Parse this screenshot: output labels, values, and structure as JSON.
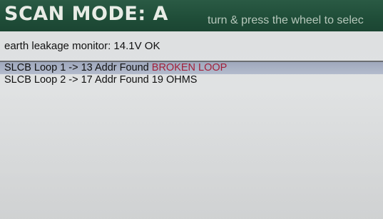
{
  "header": {
    "mode_title": "SCAN MODE: A",
    "hint": "turn & press the wheel to selec"
  },
  "status": {
    "text": "earth leakage monitor: 14.1V OK"
  },
  "loops": [
    {
      "label": "SLCB Loop 1 -> 13 Addr Found",
      "detail": "BROKEN LOOP",
      "selected": true
    },
    {
      "label": "SLCB Loop 2 -> 17 Addr Found",
      "detail": "19 OHMS",
      "selected": false
    }
  ],
  "colors": {
    "header_bg": "#1f4d38",
    "selection_bg": "#a8b0c4",
    "fault_text": "#a3203a"
  }
}
